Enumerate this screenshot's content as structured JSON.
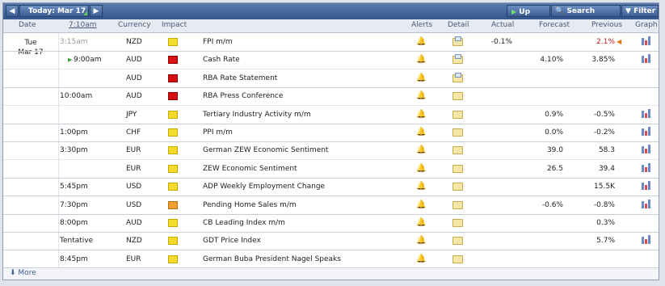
{
  "toolbar": {
    "prev_icon": "◀",
    "today_label": "Today: Mar 17",
    "next_icon": "▶",
    "up_next_label": "Up Next",
    "search_events_label": "Search Events",
    "filter_label": "Filter"
  },
  "header": {
    "date": "Date",
    "time": "7:10am",
    "currency": "Currency",
    "impact": "Impact",
    "alerts": "Alerts",
    "detail": "Detail",
    "actual": "Actual",
    "forecast": "Forecast",
    "previous": "Previous",
    "graph": "Graph"
  },
  "date": {
    "weekday": "Tue",
    "day": "Mar 17"
  },
  "rows": [
    {
      "time": "3:15am",
      "currency": "NZD",
      "impact": "low",
      "event": "FPI m/m",
      "actual": "-0.1%",
      "forecast": "",
      "previous": "2.1%",
      "previous_revised": true,
      "graph": true
    },
    {
      "time": "9:00am",
      "currency": "AUD",
      "impact": "high",
      "event": "Cash Rate",
      "actual": "",
      "forecast": "4.10%",
      "previous": "3.85%",
      "graph": true
    },
    {
      "time": "",
      "currency": "AUD",
      "impact": "high",
      "event": "RBA Rate Statement",
      "actual": "",
      "forecast": "",
      "previous": "",
      "graph": false
    },
    {
      "time": "10:00am",
      "currency": "AUD",
      "impact": "high",
      "event": "RBA Press Conference",
      "actual": "",
      "forecast": "",
      "previous": "",
      "graph": false
    },
    {
      "time": "",
      "currency": "JPY",
      "impact": "low",
      "event": "Tertiary Industry Activity m/m",
      "actual": "",
      "forecast": "0.9%",
      "previous": "-0.5%",
      "graph": true
    },
    {
      "time": "1:00pm",
      "currency": "CHF",
      "impact": "low",
      "event": "PPI m/m",
      "actual": "",
      "forecast": "0.0%",
      "previous": "-0.2%",
      "graph": true
    },
    {
      "time": "3:30pm",
      "currency": "EUR",
      "impact": "low",
      "event": "German ZEW Economic Sentiment",
      "actual": "",
      "forecast": "39.0",
      "previous": "58.3",
      "graph": true
    },
    {
      "time": "",
      "currency": "EUR",
      "impact": "low",
      "event": "ZEW Economic Sentiment",
      "actual": "",
      "forecast": "26.5",
      "previous": "39.4",
      "graph": true
    },
    {
      "time": "5:45pm",
      "currency": "USD",
      "impact": "low",
      "event": "ADP Weekly Employment Change",
      "actual": "",
      "forecast": "",
      "previous": "15.5K",
      "graph": true
    },
    {
      "time": "7:30pm",
      "currency": "USD",
      "impact": "medium",
      "event": "Pending Home Sales m/m",
      "actual": "",
      "forecast": "-0.6%",
      "previous": "-0.8%",
      "graph": true
    },
    {
      "time": "8:00pm",
      "currency": "AUD",
      "impact": "low",
      "event": "CB Leading Index m/m",
      "actual": "",
      "forecast": "",
      "previous": "0.3%",
      "graph": false
    },
    {
      "time": "Tentative",
      "currency": "NZD",
      "impact": "low",
      "event": "GDT Price Index",
      "actual": "",
      "forecast": "",
      "previous": "5.7%",
      "graph": true
    },
    {
      "time": "8:45pm",
      "currency": "EUR",
      "impact": "low",
      "event": "German Buba President Nagel Speaks",
      "actual": "",
      "forecast": "",
      "previous": "",
      "graph": false
    }
  ],
  "footer": {
    "more_label": "More"
  },
  "colors": {
    "toolbar": "#3e5f95",
    "high": "#d81212",
    "medium": "#f0a030",
    "low": "#f5dc2a"
  }
}
